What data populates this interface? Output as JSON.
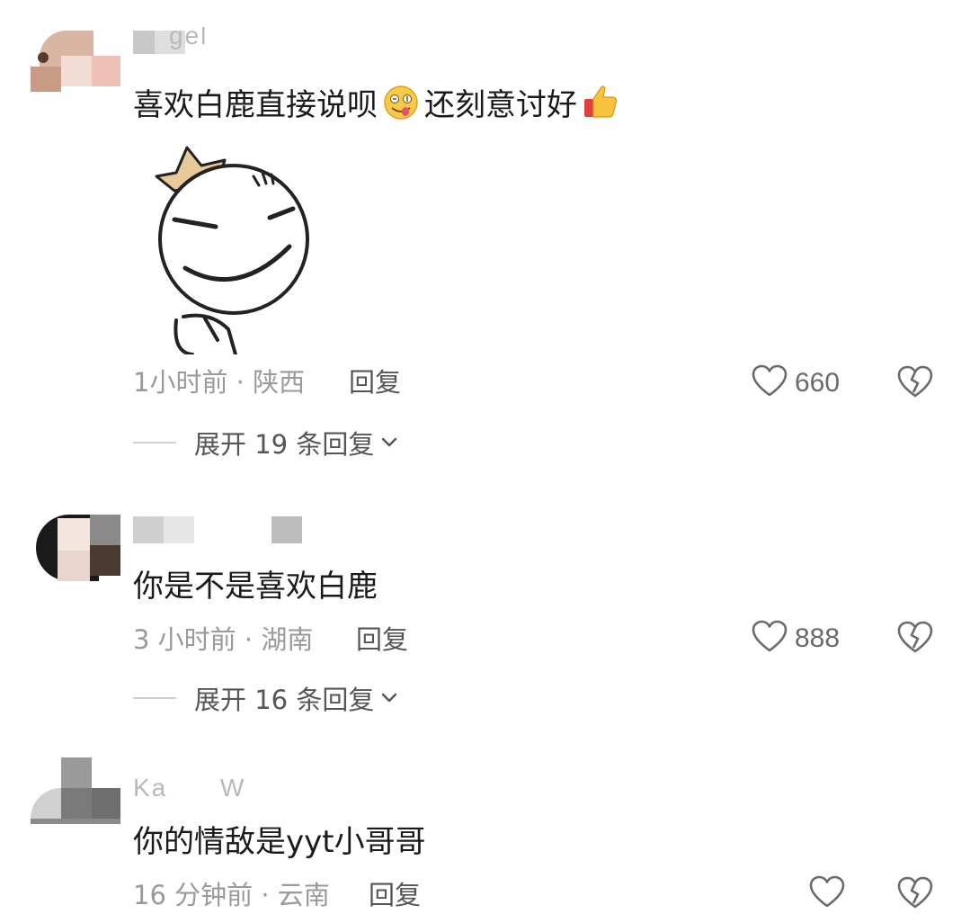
{
  "comments": [
    {
      "username": "gel",
      "text_a": "喜欢白鹿直接说呗",
      "emoji_1": "drooling-face-emoji",
      "text_b": "还刻意讨好",
      "emoji_2": "thumbs-up-emoji",
      "sticker": "smug-round-face-sticker",
      "time": "1小时前",
      "location": "陕西",
      "reply_label": "回复",
      "likes": "660",
      "expand_label": "展开 19 条回复"
    },
    {
      "username": "",
      "text": "你是不是喜欢白鹿",
      "time": "3 小时前",
      "location": "湖南",
      "reply_label": "回复",
      "likes": "888",
      "expand_label": "展开 16 条回复"
    },
    {
      "username": "Ka      W",
      "text": "你的情敌是yyt小哥哥",
      "time": "16 分钟前",
      "location": "云南",
      "reply_label": "回复"
    }
  ],
  "separator": " · ",
  "icons": {
    "like": "heart-outline-icon",
    "dislike": "broken-heart-icon",
    "expand": "chevron-down-icon"
  },
  "colors": {
    "text": "#1a1a1a",
    "meta": "#9a9a9a",
    "icon": "#6a6a6a"
  }
}
